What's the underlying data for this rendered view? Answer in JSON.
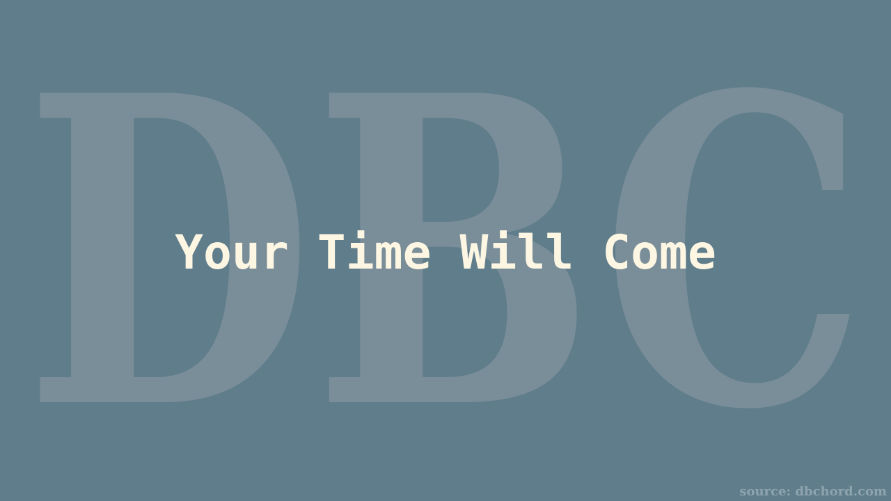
{
  "watermark": {
    "text": "DBC",
    "color": "#7a8e99"
  },
  "background_color": "#607d8b",
  "title": {
    "text": "Your Time Will Come",
    "color": "#fdf6e3"
  },
  "footer": {
    "source_text": "source: dbchord.com"
  }
}
